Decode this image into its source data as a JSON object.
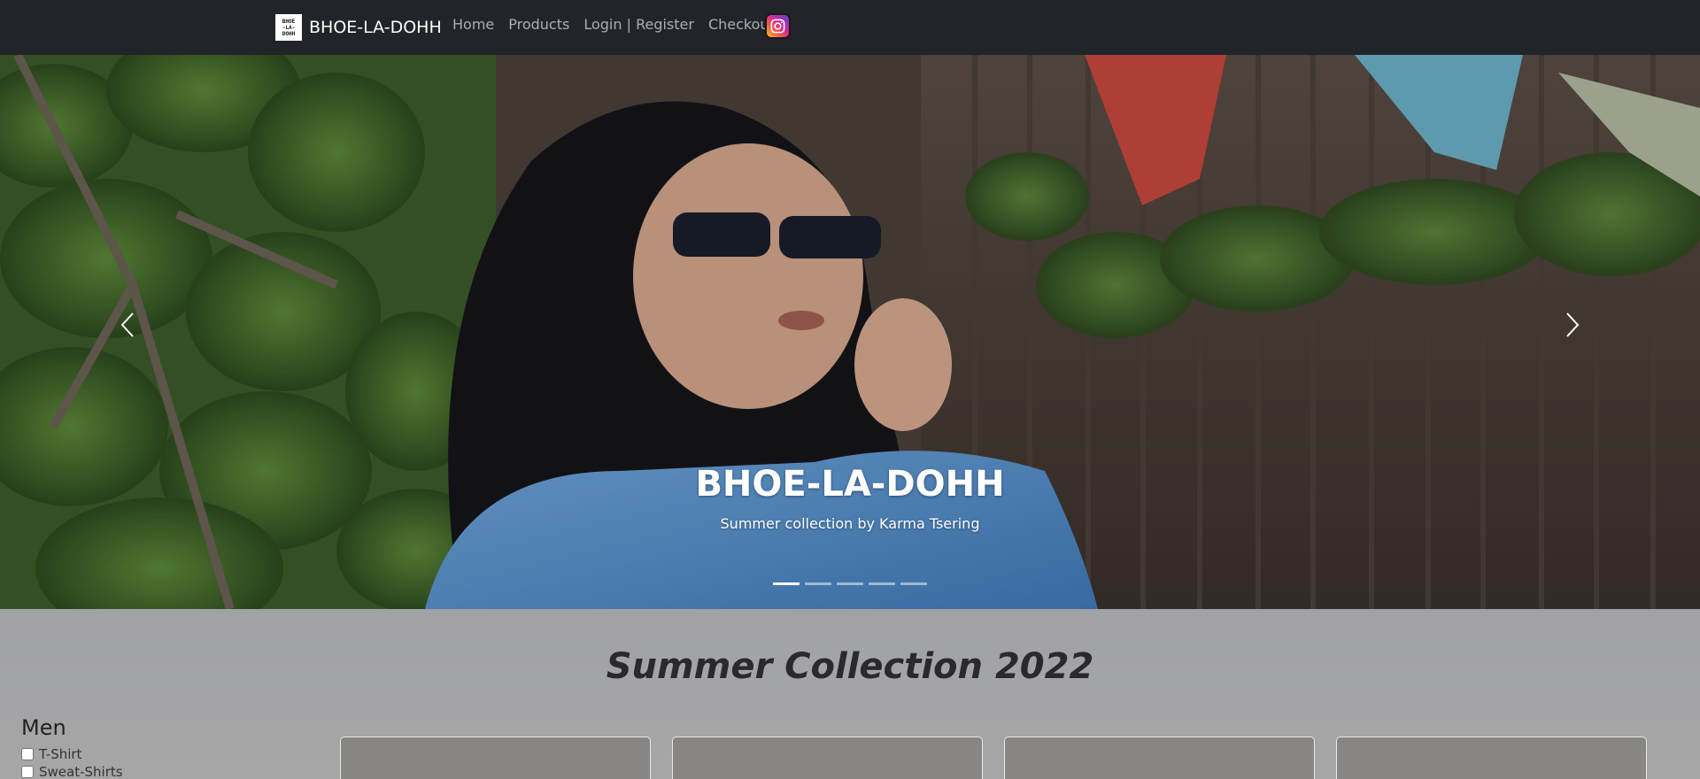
{
  "navbar": {
    "brand_name": "BHOE-LA-DOHH",
    "logo_lines": [
      "BHOE",
      "-LA-",
      "DOHH"
    ],
    "links": [
      "Home",
      "Products",
      "Login | Register",
      "Checkout"
    ],
    "instagram_icon": "instagram-icon"
  },
  "carousel": {
    "title": "BHOE-LA-DOHH",
    "subtitle": "Summer collection by Karma Tsering",
    "slide_count": 5,
    "active_slide": 1
  },
  "main": {
    "section_title": "Summer Collection 2022",
    "filter": {
      "heading": "Men",
      "options": [
        "T-Shirt",
        "Sweat-Shirts"
      ]
    },
    "product_cards": 4
  },
  "colors": {
    "navbar_bg": "#212529",
    "page_bg": "#a6a6a6",
    "card_bg": "#878683"
  }
}
